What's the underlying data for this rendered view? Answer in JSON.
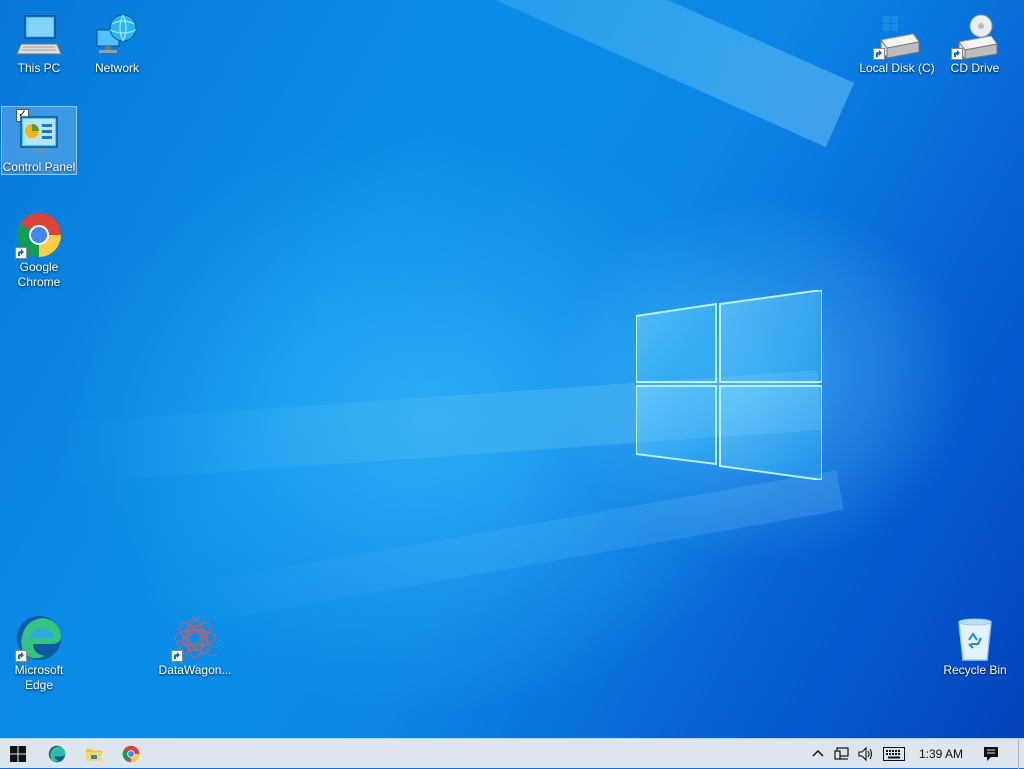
{
  "desktop": {
    "icons": [
      {
        "label": "This PC",
        "icon": "computer-icon",
        "shortcut": false
      },
      {
        "label": "Network",
        "icon": "network-globe-icon",
        "shortcut": false
      },
      {
        "label": "Local Disk (C)",
        "icon": "hard-drive-icon",
        "shortcut": true
      },
      {
        "label": "CD Drive",
        "icon": "cd-drive-icon",
        "shortcut": true
      },
      {
        "label": "Control Panel",
        "icon": "control-panel-icon",
        "shortcut": false,
        "selected": true
      },
      {
        "label": "Google Chrome",
        "icon": "chrome-icon",
        "shortcut": true
      },
      {
        "label": "Microsoft Edge",
        "icon": "edge-icon",
        "shortcut": true
      },
      {
        "label": "DataWagon...",
        "icon": "datawagon-icon",
        "shortcut": true
      },
      {
        "label": "Recycle Bin",
        "icon": "recycle-bin-icon",
        "shortcut": false
      }
    ]
  },
  "taskbar": {
    "start_icon": "windows-start-icon",
    "pinned": [
      {
        "name": "edge-icon"
      },
      {
        "name": "file-explorer-icon"
      },
      {
        "name": "chrome-icon"
      }
    ],
    "tray": {
      "chevron_icon": "chevron-up-icon",
      "network_icon": "network-tray-icon",
      "volume_icon": "volume-icon",
      "keyboard_icon": "touch-keyboard-icon",
      "time": "1:39 AM",
      "notification_icon": "action-center-icon"
    }
  },
  "colors": {
    "accent": "#0a78d7",
    "taskbar_bg": "#dde5ee"
  }
}
